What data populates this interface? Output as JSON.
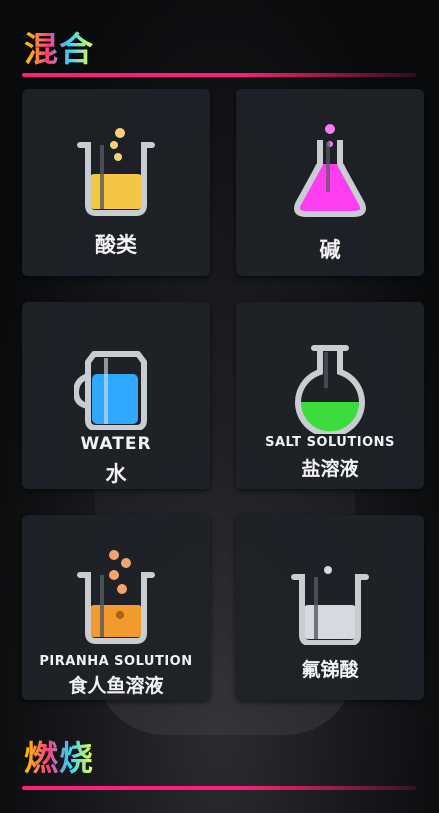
{
  "sections": {
    "mix_title": "混合",
    "burn_title": "燃烧"
  },
  "cards": [
    {
      "zh": "酸类",
      "en": ""
    },
    {
      "zh": "碱",
      "en": ""
    },
    {
      "zh": "水",
      "en": "WATER"
    },
    {
      "zh": "盐溶液",
      "en": "SALT SOLUTIONS"
    },
    {
      "zh": "食人鱼溶液",
      "en": "PIRANHA SOLUTION"
    },
    {
      "zh": "氟锑酸",
      "en": ""
    }
  ],
  "colors": {
    "divider": "#ff1f7a",
    "card_bg": "#1f2227",
    "acid_liquid": "#f4c542",
    "base_liquid": "#ff3df0",
    "water_liquid": "#2fa8ff",
    "salt_liquid": "#3ddc3d",
    "piranha_liquid": "#f29a2e",
    "fluoro_liquid": "#d6d9df"
  },
  "icons": [
    "beaker-acid-icon",
    "flask-base-icon",
    "pitcher-water-icon",
    "round-flask-salt-icon",
    "beaker-piranha-icon",
    "beaker-fluoroantimonic-icon"
  ]
}
